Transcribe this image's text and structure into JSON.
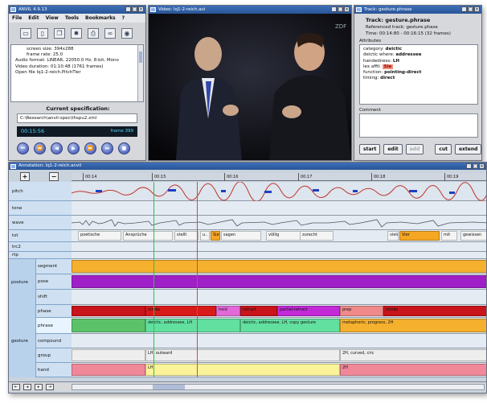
{
  "main_window": {
    "title": "ANVIL 4.9.13",
    "menu": [
      "File",
      "Edit",
      "View",
      "Tools",
      "Bookmarks",
      "?"
    ],
    "toolbar_icons": [
      "folder-icon",
      "doc-icon",
      "copy-icon",
      "gear-icon",
      "print-icon",
      "binoculars-icon",
      "eye-icon"
    ],
    "info_lines": [
      "screen size: 394x288",
      "frame rate: 25.0",
      "Audio format: LINEAR, 22050.0 Hz, 8-bit, Mono",
      "Video duration: 01:10:48 (1761 frames)",
      "Open file lq1-2-reich.PitchTier"
    ],
    "spec_title": "Current specification:",
    "spec_path": "C:\\Research\\anvil-spec\\thspu2.xml",
    "time": "00:15:56",
    "frame": "frame 399",
    "player_buttons": [
      "⏮",
      "⏪",
      "◀",
      "▶",
      "⏩",
      "⏭",
      "■"
    ]
  },
  "video_window": {
    "title": "Video: lq1-2-reich.avi",
    "logo": "ZDF"
  },
  "track_window": {
    "title": "Track: gesture.phrase",
    "heading": "Track: gesture.phrase",
    "ref_track": "Referenced track: gesture.phase",
    "time": "Time: 00:14:80 - 00:16:15 (32 frames)",
    "attributes_label": "Attributes",
    "attributes": [
      {
        "key": "category",
        "value": "deictic"
      },
      {
        "key": "deictic where",
        "value": "addressee"
      },
      {
        "key": "handedness",
        "value": "LH"
      },
      {
        "key": "lex affil",
        "value": "Sie",
        "highlight": true
      },
      {
        "key": "function",
        "value": "pointing-direct"
      },
      {
        "key": "timing",
        "value": "direct"
      }
    ],
    "comment_label": "Comment",
    "buttons": [
      {
        "label": "start",
        "enabled": true
      },
      {
        "label": "edit",
        "enabled": true
      },
      {
        "label": "add",
        "enabled": false
      },
      {
        "label": "cut",
        "enabled": true
      },
      {
        "label": "extend",
        "enabled": true
      }
    ]
  },
  "annotation_window": {
    "title": "Annotation: lq1-2-reich.anvil",
    "zoom_in": "+",
    "zoom_out": "−",
    "ticks": [
      "00:14",
      "00:15",
      "00:16",
      "00:17",
      "00:18",
      "00:19"
    ],
    "tracks": [
      {
        "name": "pitch"
      },
      {
        "name": "tone"
      },
      {
        "name": "wave"
      },
      {
        "name": "txt"
      },
      {
        "name": "trc2"
      },
      {
        "name": "rtp"
      },
      {
        "group": "posture",
        "name": "segment"
      },
      {
        "group": "posture",
        "name": "pose"
      },
      {
        "group": "posture",
        "name": "shift"
      },
      {
        "group": "gesture",
        "name": "phase"
      },
      {
        "group": "gesture",
        "name": "phrase"
      },
      {
        "group": "gesture",
        "name": "compound"
      },
      {
        "group": "gesture",
        "name": "group"
      },
      {
        "group": "gesture",
        "name": "hand"
      }
    ],
    "words": [
      "poetische",
      "Ansprüche",
      "stellt",
      "u..",
      "Sie",
      "sagen",
      "völlig",
      "zurecht",
      "viele",
      "Vier",
      "mit",
      "gewissen"
    ],
    "phase_labels": [
      "stroke",
      "hold",
      "retract",
      "partial-retract",
      "prep",
      "stroke"
    ],
    "phrase_labels": [
      "deictic, addressee, LH",
      "deictic, addressee, LH, copy gesture",
      "metaphoric, progress, 2H"
    ],
    "group_labels": [
      "LH, outward",
      "2H, curved, circ"
    ],
    "hand_labels": [
      "LH",
      "2H"
    ],
    "colors": {
      "segment": "#f5b02e",
      "pose": "#a020c8",
      "phase_stroke": "#c8141a",
      "phrase_green": "#5cc26a",
      "hand_pink": "#f0889a"
    }
  }
}
